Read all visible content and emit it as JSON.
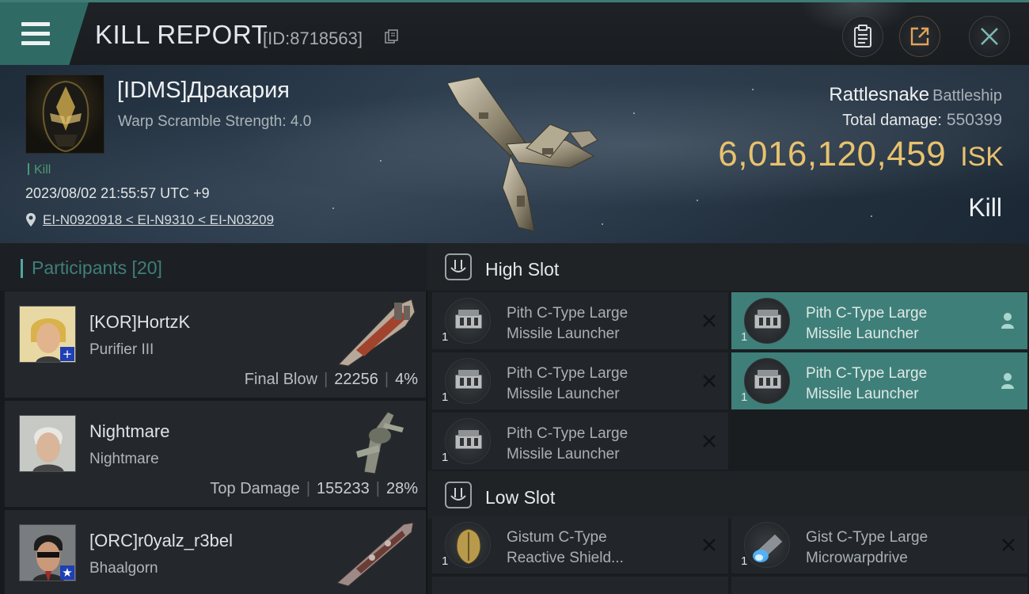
{
  "header": {
    "title": "KILL REPORT",
    "report_id": "[ID:8718563]"
  },
  "victim": {
    "name": "[IDMS]Дракария",
    "warp_scramble": "Warp Scramble Strength: 4.0",
    "tag": "Kill",
    "time": "2023/08/02 21:55:57 UTC +9",
    "location": "EI-N0920918 < EI-N9310 < EI-N03209",
    "ship_name": "Rattlesnake",
    "ship_class": "Battleship",
    "total_damage_label": "Total damage:",
    "total_damage": "550399",
    "isk_value": "6,016,120,459",
    "isk_unit": "ISK",
    "result": "Kill"
  },
  "participants": {
    "title": "Participants [20]",
    "items": [
      {
        "name": "[KOR]HortzK",
        "ship": "Purifier III",
        "role": "Final Blow",
        "damage": "22256",
        "percent": "4%",
        "badge": "+"
      },
      {
        "name": "Nightmare",
        "ship": "Nightmare",
        "role": "Top Damage",
        "damage": "155233",
        "percent": "28%",
        "badge": ""
      },
      {
        "name": "[ORC]r0yalz_r3bel",
        "ship": "Bhaalgorn",
        "role": "",
        "damage": "",
        "percent": "",
        "badge": "★"
      }
    ]
  },
  "fitting": {
    "high_slot": {
      "title": "High Slot",
      "modules": [
        {
          "name_line1": "Pith C-Type Large",
          "name_line2": "Missile Launcher",
          "qty": "1",
          "state": "destroyed"
        },
        {
          "name_line1": "Pith C-Type Large",
          "name_line2": "Missile Launcher",
          "qty": "1",
          "state": "dropped"
        },
        {
          "name_line1": "Pith C-Type Large",
          "name_line2": "Missile Launcher",
          "qty": "1",
          "state": "destroyed"
        },
        {
          "name_line1": "Pith C-Type Large",
          "name_line2": "Missile Launcher",
          "qty": "1",
          "state": "dropped"
        },
        {
          "name_line1": "Pith C-Type Large",
          "name_line2": "Missile Launcher",
          "qty": "1",
          "state": "destroyed"
        }
      ]
    },
    "low_slot": {
      "title": "Low Slot",
      "modules": [
        {
          "name_line1": "Gistum C-Type",
          "name_line2": "Reactive Shield...",
          "qty": "1",
          "state": "destroyed"
        },
        {
          "name_line1": "Gist C-Type Large",
          "name_line2": "Microwarpdrive",
          "qty": "1",
          "state": "destroyed"
        }
      ]
    }
  },
  "colors": {
    "accent": "#3f7f79",
    "isk": "#e8c26e",
    "kill_tag": "#4c9a72"
  },
  "icons": {
    "menu": "hamburger-icon",
    "copy": "copy-icon",
    "clipboard": "clipboard-icon",
    "share": "share-icon",
    "close": "close-icon",
    "location": "location-pin-icon",
    "slot": "slot-icon",
    "destroyed": "x-icon",
    "dropped": "person-icon"
  }
}
